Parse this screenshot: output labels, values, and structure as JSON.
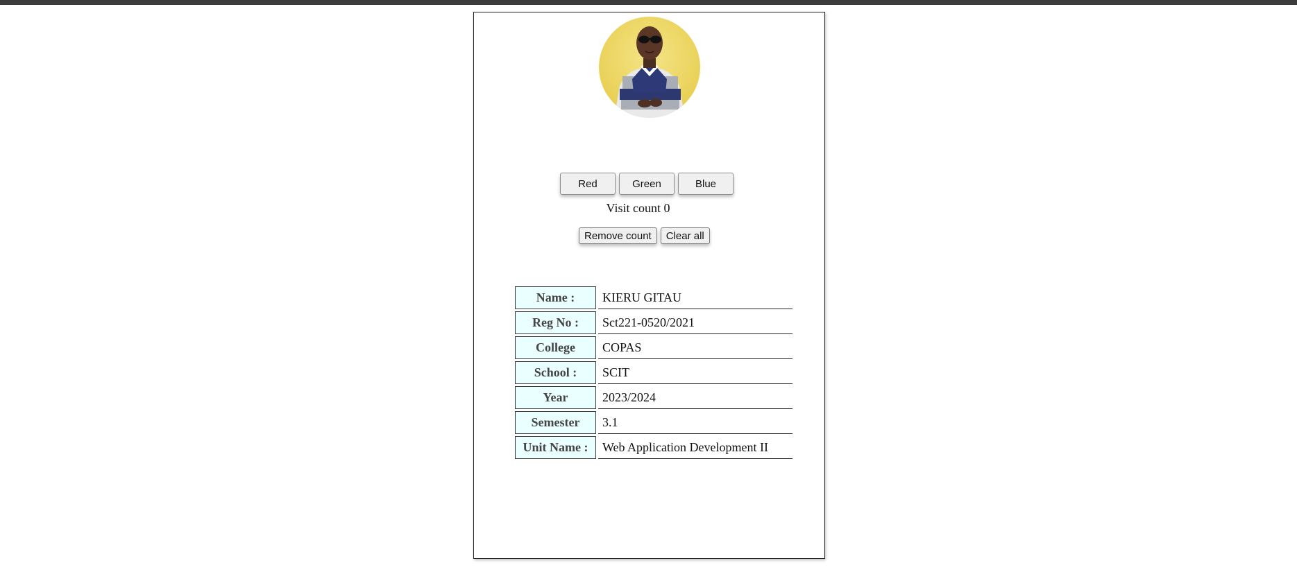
{
  "profile": {
    "avatar_alt": "Profile photo"
  },
  "colors": {
    "buttons": [
      {
        "label": "Red"
      },
      {
        "label": "Green"
      },
      {
        "label": "Blue"
      }
    ]
  },
  "visit": {
    "text": "Visit count 0"
  },
  "count_controls": {
    "remove_label": "Remove count",
    "clear_label": "Clear all"
  },
  "details": {
    "rows": [
      {
        "label": "Name :",
        "value": "KIERU GITAU"
      },
      {
        "label": "Reg No :",
        "value": "Sct221-0520/2021"
      },
      {
        "label": "College",
        "value": "COPAS"
      },
      {
        "label": "School :",
        "value": "SCIT"
      },
      {
        "label": "Year",
        "value": "2023/2024"
      },
      {
        "label": "Semester",
        "value": "3.1"
      },
      {
        "label": "Unit Name :",
        "value": "Web Application Development II"
      }
    ]
  },
  "theme": {
    "label_bg": "#eaffff",
    "avatar_bg": "#f1dc6a"
  }
}
